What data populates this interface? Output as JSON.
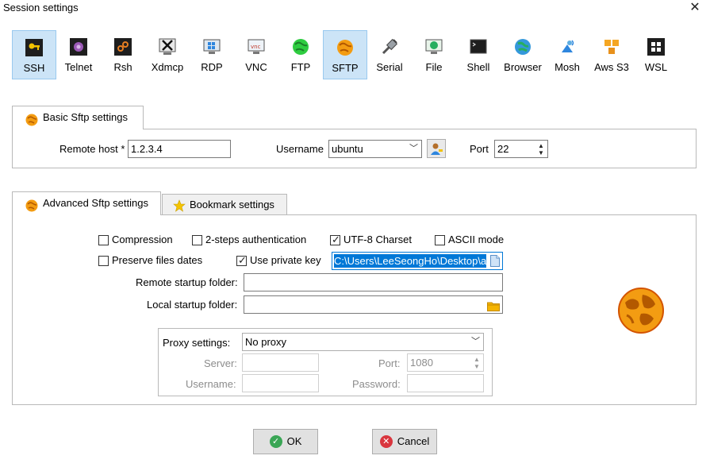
{
  "window": {
    "title": "Session settings",
    "close_glyph": "✕"
  },
  "session_types": [
    {
      "label": "SSH",
      "icon": "key-icon",
      "active": true
    },
    {
      "label": "Telnet",
      "icon": "telnet-icon"
    },
    {
      "label": "Rsh",
      "icon": "rsh-icon"
    },
    {
      "label": "Xdmcp",
      "icon": "xdmcp-icon"
    },
    {
      "label": "RDP",
      "icon": "rdp-icon"
    },
    {
      "label": "VNC",
      "icon": "vnc-icon"
    },
    {
      "label": "FTP",
      "icon": "ftp-icon"
    },
    {
      "label": "SFTP",
      "icon": "sftp-icon",
      "active": true
    },
    {
      "label": "Serial",
      "icon": "serial-icon"
    },
    {
      "label": "File",
      "icon": "file-icon"
    },
    {
      "label": "Shell",
      "icon": "shell-icon"
    },
    {
      "label": "Browser",
      "icon": "browser-icon"
    },
    {
      "label": "Mosh",
      "icon": "mosh-icon"
    },
    {
      "label": "Aws S3",
      "icon": "aws-s3-icon"
    },
    {
      "label": "WSL",
      "icon": "wsl-icon"
    }
  ],
  "basic": {
    "tab_label": "Basic Sftp settings",
    "remote_host_label": "Remote host *",
    "remote_host_value": "1.2.3.4",
    "username_label": "Username",
    "username_value": "ubuntu",
    "port_label": "Port",
    "port_value": "22"
  },
  "advanced": {
    "tab_label": "Advanced Sftp settings",
    "bookmark_tab_label": "Bookmark settings",
    "options": {
      "compression": {
        "label": "Compression",
        "checked": false
      },
      "two_steps": {
        "label": "2-steps authentication",
        "checked": false
      },
      "utf8": {
        "label": "UTF-8 Charset",
        "checked": true
      },
      "ascii": {
        "label": "ASCII mode",
        "checked": false
      },
      "preserve_dates": {
        "label": "Preserve files dates",
        "checked": false
      },
      "use_private_key": {
        "label": "Use private key",
        "checked": true
      }
    },
    "private_key_path": "C:\\Users\\LeeSeongHo\\Desktop\\a",
    "remote_startup_label": "Remote startup folder:",
    "remote_startup_value": "",
    "local_startup_label": "Local startup folder:",
    "local_startup_value": "",
    "proxy": {
      "label": "Proxy settings:",
      "value": "No proxy",
      "server_label": "Server:",
      "server_value": "",
      "port_label": "Port:",
      "port_value": "1080",
      "username_label": "Username:",
      "username_value": "",
      "password_label": "Password:",
      "password_value": ""
    }
  },
  "buttons": {
    "ok": "OK",
    "cancel": "Cancel"
  },
  "colors": {
    "active_bg": "#cce4f7",
    "active_border": "#99c9ef",
    "sftp_orange": "#f39c12",
    "ok_green": "#3aa655",
    "cancel_red": "#d9363e",
    "selection": "#0078d7"
  }
}
